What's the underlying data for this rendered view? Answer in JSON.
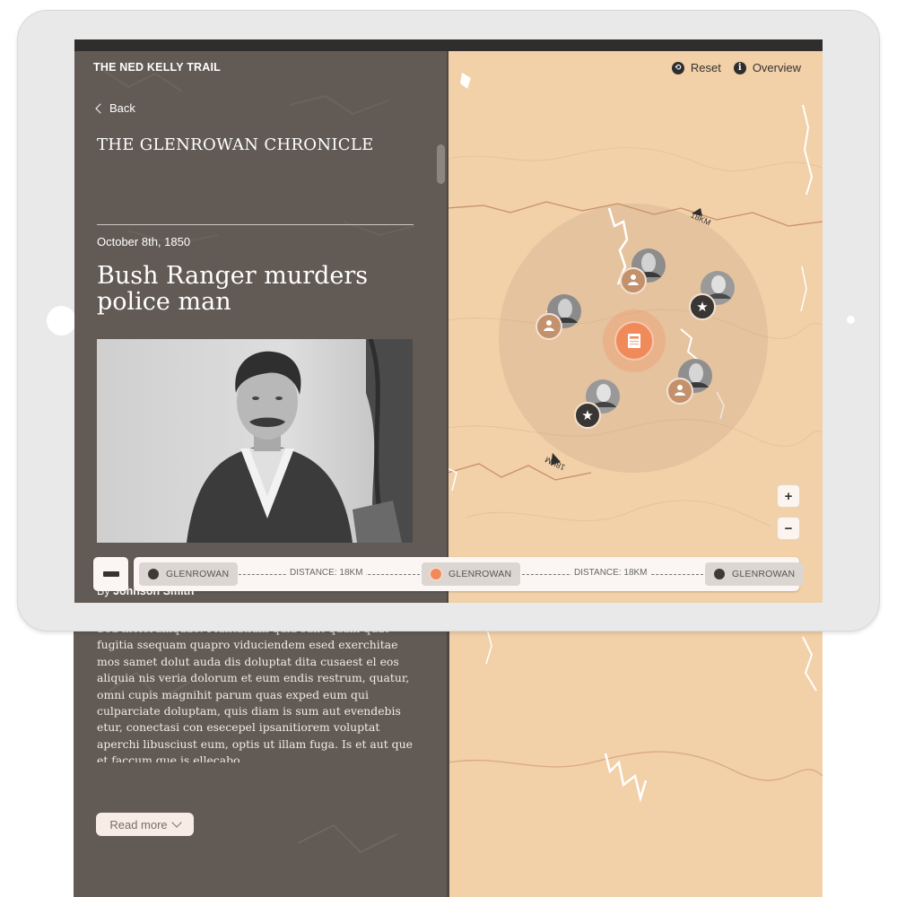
{
  "app": {
    "title": "THE NED KELLY TRAIL"
  },
  "nav": {
    "back_label": "Back"
  },
  "article": {
    "publication": "THE GLENROWAN CHRONICLE",
    "date": "October 8th, 1850",
    "headline": "Bush Ranger murders police man",
    "byline_prefix": "By",
    "byline_author": "Johnson Smith",
    "body": "Sed molorumquae. Pluntatium quia sunt quam quat fugitia ssequam quapro viduciendem esed exerchitae mos samet dolut auda dis doluptat dita cusaest el eos aliquia nis veria dolorum et eum endis restrum, quatur, omni cupis magnihit parum quas exped eum qui culparciate doluptam, quis diam is sum aut evendebis etur, conectasi con esecepel ipsanitiorem voluptat aperchi libusciust eum, optis ut illam fuga. Is et aut que et faccum que is ellecabo",
    "read_more_label": "Read more"
  },
  "map": {
    "reset_label": "Reset",
    "overview_label": "Overview",
    "zoom_in_label": "+",
    "zoom_out_label": "−",
    "distance_markers": [
      "18KM",
      "18KM"
    ],
    "markers": [
      {
        "type": "person-icon"
      },
      {
        "type": "star-icon"
      },
      {
        "type": "person-icon"
      },
      {
        "type": "person-icon"
      },
      {
        "type": "star-icon"
      },
      {
        "type": "newspaper-icon"
      }
    ],
    "accent_color": "#f08a5a"
  },
  "timeline": {
    "stops": [
      {
        "label": "GLENROWAN",
        "active": false
      },
      {
        "label": "GLENROWAN",
        "active": true
      },
      {
        "label": "GLENROWAN",
        "active": false
      }
    ],
    "distances": [
      "DISTANCE: 18KM",
      "DISTANCE: 18KM"
    ]
  }
}
